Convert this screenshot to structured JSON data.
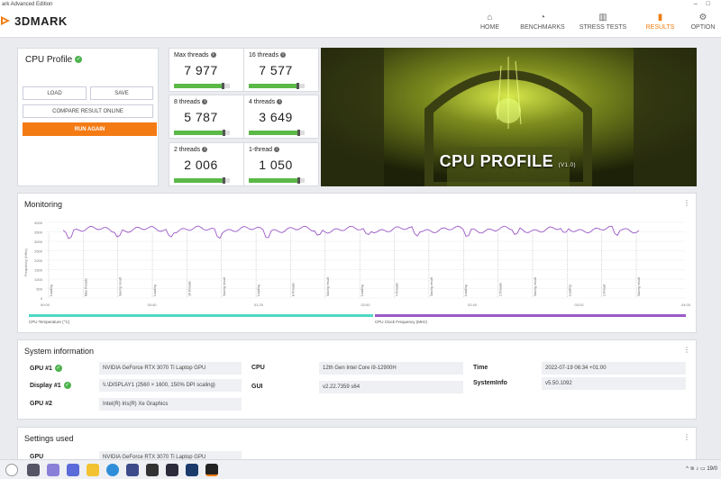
{
  "window": {
    "title": "ark Advanced Edition"
  },
  "header": {
    "logo": "3DMARK",
    "nav": [
      {
        "label": "HOME",
        "icon": "home-icon",
        "glyph": "⌂"
      },
      {
        "label": "BENCHMARKS",
        "icon": "gauge-icon",
        "glyph": "◔"
      },
      {
        "label": "STRESS TESTS",
        "icon": "bar-chart-icon",
        "glyph": "▥"
      },
      {
        "label": "RESULTS",
        "icon": "results-icon",
        "glyph": "▮"
      },
      {
        "label": "OPTION",
        "icon": "gear-icon",
        "glyph": "⚙"
      }
    ],
    "active_nav": "RESULTS"
  },
  "cpu_card": {
    "title": "CPU Profile",
    "load_label": "LOAD",
    "save_label": "SAVE",
    "compare_label": "COMPARE RESULT ONLINE",
    "run_label": "RUN AGAIN"
  },
  "scores": [
    {
      "label": "Max threads",
      "value": "7 977",
      "level": 0.86
    },
    {
      "label": "16 threads",
      "value": "7 577",
      "level": 0.86
    },
    {
      "label": "8 threads",
      "value": "5 787",
      "level": 0.87
    },
    {
      "label": "4 threads",
      "value": "3 649",
      "level": 0.87
    },
    {
      "label": "2 threads",
      "value": "2 006",
      "level": 0.87
    },
    {
      "label": "1-thread",
      "value": "1 050",
      "level": 0.87
    }
  ],
  "hero": {
    "title": "CPU PROFILE",
    "version": "(V1.0)"
  },
  "monitoring": {
    "title": "Monitoring",
    "y_axis_label": "Frequency (MHz)",
    "y_ticks": [
      "4000",
      "3500",
      "3000",
      "2500",
      "2000",
      "1500",
      "1000",
      "500",
      "0"
    ],
    "x_ticks": [
      "00:00",
      "00:40",
      "01:20",
      "02:00",
      "02:40",
      "03:20",
      "04:00"
    ],
    "phase_labels": [
      "Loading",
      "Max threads",
      "Saving result",
      "Loading",
      "16 threads",
      "Saving result",
      "Loading",
      "8 threads",
      "Saving result",
      "Loading",
      "4 threads",
      "Saving result",
      "Loading",
      "2 threads",
      "Saving result",
      "Loading",
      "1 thread",
      "Saving result"
    ],
    "legend": [
      {
        "label": "CPU Temperature (°C)",
        "color": "#4fd8c4"
      },
      {
        "label": "CPU Clock Frequency (MHz)",
        "color": "#9b59c6"
      }
    ]
  },
  "system_info": {
    "title": "System information",
    "gpu1_label": "GPU #1",
    "gpu1_value": "NVIDIA GeForce RTX 3070 Ti Laptop GPU",
    "display1_label": "Display #1",
    "display1_value": "\\\\.\\DISPLAY1 (2560 × 1600, 150% DPI scaling)",
    "gpu2_label": "GPU #2",
    "gpu2_value": "Intel(R) Iris(R) Xe Graphics",
    "cpu_label": "CPU",
    "cpu_value": "12th Gen Intel Core i9-12900H",
    "gui_label": "GUI",
    "gui_value": "v2.22.7359 s64",
    "time_label": "Time",
    "time_value": "2022-07-19 06:34 +01:00",
    "sysinfo_label": "SystemInfo",
    "sysinfo_value": "v5.50.1092"
  },
  "settings": {
    "title": "Settings used",
    "gpu_label": "GPU",
    "gpu_value": "NVIDIA GeForce RTX 3070 Ti Laptop GPU"
  },
  "taskbar": {
    "clock": "19/0"
  },
  "colors": {
    "accent": "#f47b14",
    "score_bar": "#5bb947",
    "check": "#4db34d"
  }
}
